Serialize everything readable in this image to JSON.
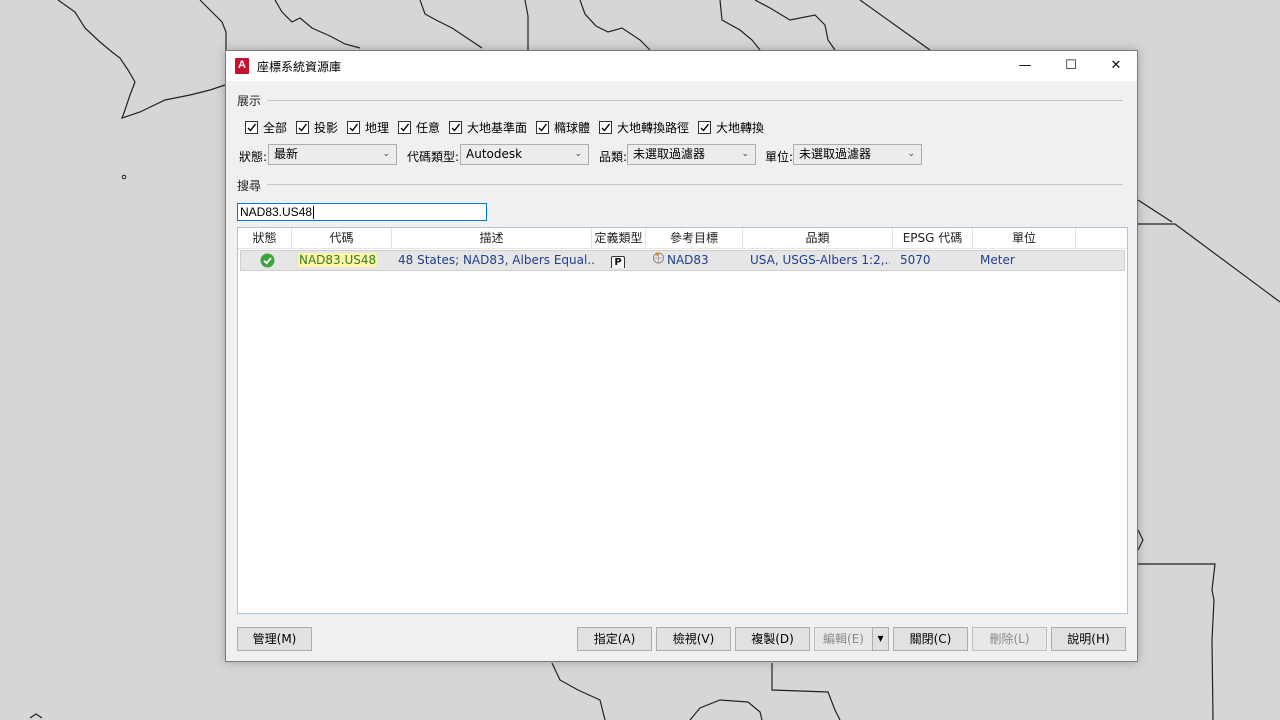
{
  "dialog": {
    "title": "座標系統資源庫",
    "app_icon": "A",
    "window_controls": {
      "minimize": "—",
      "maximize": "☐",
      "close": "✕"
    }
  },
  "display": {
    "group_label": "展示",
    "filters": [
      {
        "label": "全部",
        "checked": true
      },
      {
        "label": "投影",
        "checked": true
      },
      {
        "label": "地理",
        "checked": true
      },
      {
        "label": "任意",
        "checked": true
      },
      {
        "label": "大地基準面",
        "checked": true
      },
      {
        "label": "橢球體",
        "checked": true
      },
      {
        "label": "大地轉換路徑",
        "checked": true
      },
      {
        "label": "大地轉換",
        "checked": true
      }
    ]
  },
  "filters": {
    "status": {
      "label": "狀態:",
      "value": "最新"
    },
    "code_type": {
      "label": "代碼類型:",
      "value": "Autodesk"
    },
    "category": {
      "label": "品類:",
      "value": "未選取過濾器"
    },
    "unit": {
      "label": "單位:",
      "value": "未選取過濾器"
    }
  },
  "search": {
    "group_label": "搜尋",
    "value": "NAD83.US48"
  },
  "table": {
    "columns": [
      "狀態",
      "代碼",
      "描述",
      "定義類型",
      "參考目標",
      "品類",
      "EPSG 代碼",
      "單位"
    ],
    "rows": [
      {
        "status_icon": "check-circle-icon",
        "code": "NAD83.US48",
        "description": "48 States; NAD83, Albers Equal...",
        "definition_type": "P",
        "reference_icon": "datum-icon",
        "reference": "NAD83",
        "category": "USA, USGS-Albers 1:2,...",
        "epsg": "5070",
        "unit": "Meter"
      }
    ]
  },
  "buttons": {
    "manage": "管理(M)",
    "assign": "指定(A)",
    "view": "檢視(V)",
    "copy": "複製(D)",
    "edit": "編輯(E)",
    "edit_dropdown": "▾",
    "close": "關閉(C)",
    "delete": "刪除(L)",
    "help": "說明(H)"
  },
  "colors": {
    "accent": "#0078d7",
    "status_ok": "#3aa53a",
    "code_highlight": "#fbf6a8",
    "app_icon": "#c8102e"
  }
}
